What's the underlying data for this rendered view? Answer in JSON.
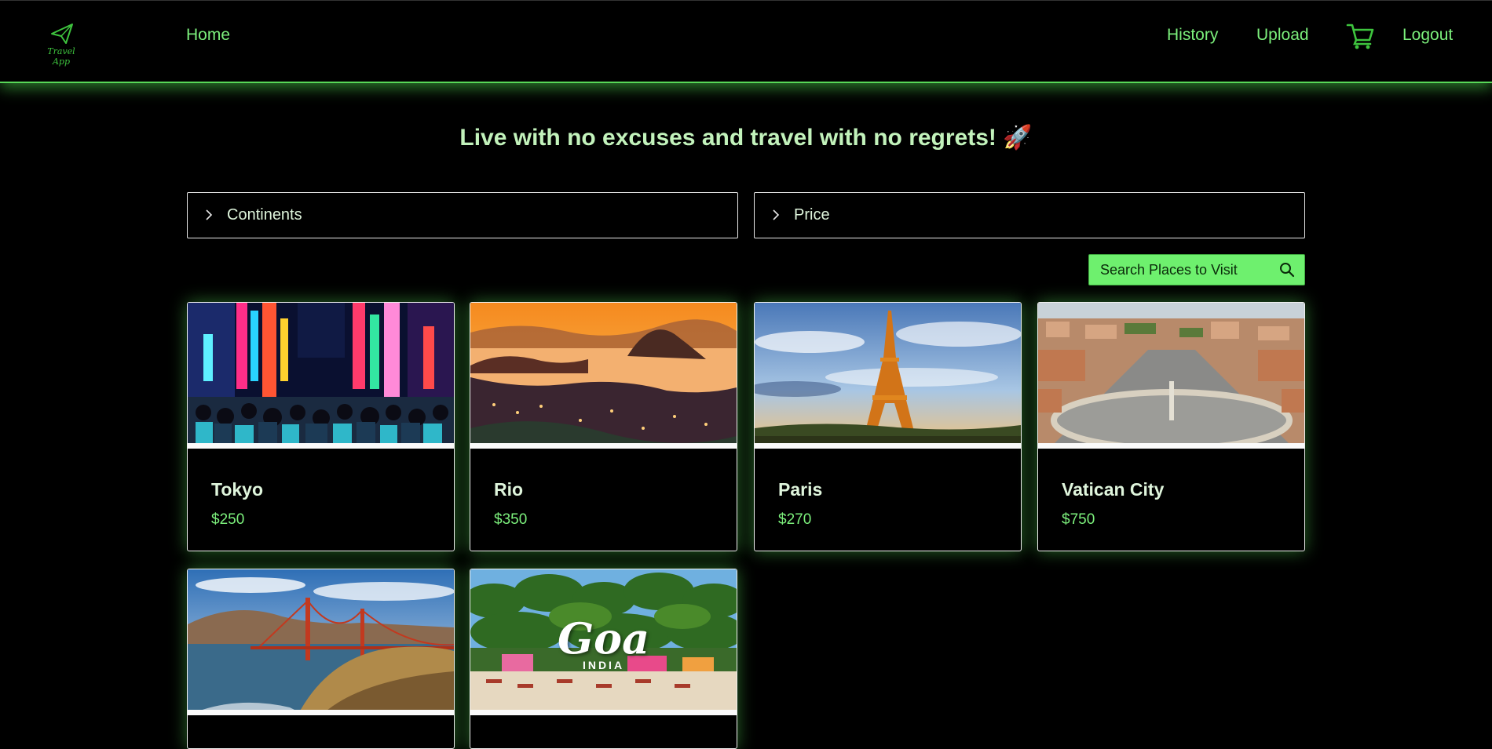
{
  "nav": {
    "logo_text": "Travel App",
    "home": "Home",
    "history": "History",
    "upload": "Upload",
    "logout": "Logout"
  },
  "tagline": "Live with no excuses and travel with no regrets! 🚀",
  "filters": {
    "continents": "Continents",
    "price": "Price"
  },
  "search": {
    "placeholder": "Search Places to Visit"
  },
  "places": [
    {
      "name": "Tokyo",
      "price": "$250",
      "image": "night-street-neon"
    },
    {
      "name": "Rio",
      "price": "$350",
      "image": "sunset-bay-sugarloaf"
    },
    {
      "name": "Paris",
      "price": "$270",
      "image": "eiffel-tower-sky"
    },
    {
      "name": "Vatican City",
      "price": "$750",
      "image": "st-peters-square-aerial"
    },
    {
      "name": "",
      "price": "",
      "image": "golden-gate-bridge-coast"
    },
    {
      "name": "",
      "price": "",
      "image": "goa-beach-palms"
    }
  ],
  "goa_overlay": {
    "title": "Goa",
    "subtitle": "INDIA"
  },
  "colors": {
    "accent": "#6ef06e",
    "nav_link": "#7cf07c",
    "glow": "#58d858",
    "background": "#000000"
  }
}
